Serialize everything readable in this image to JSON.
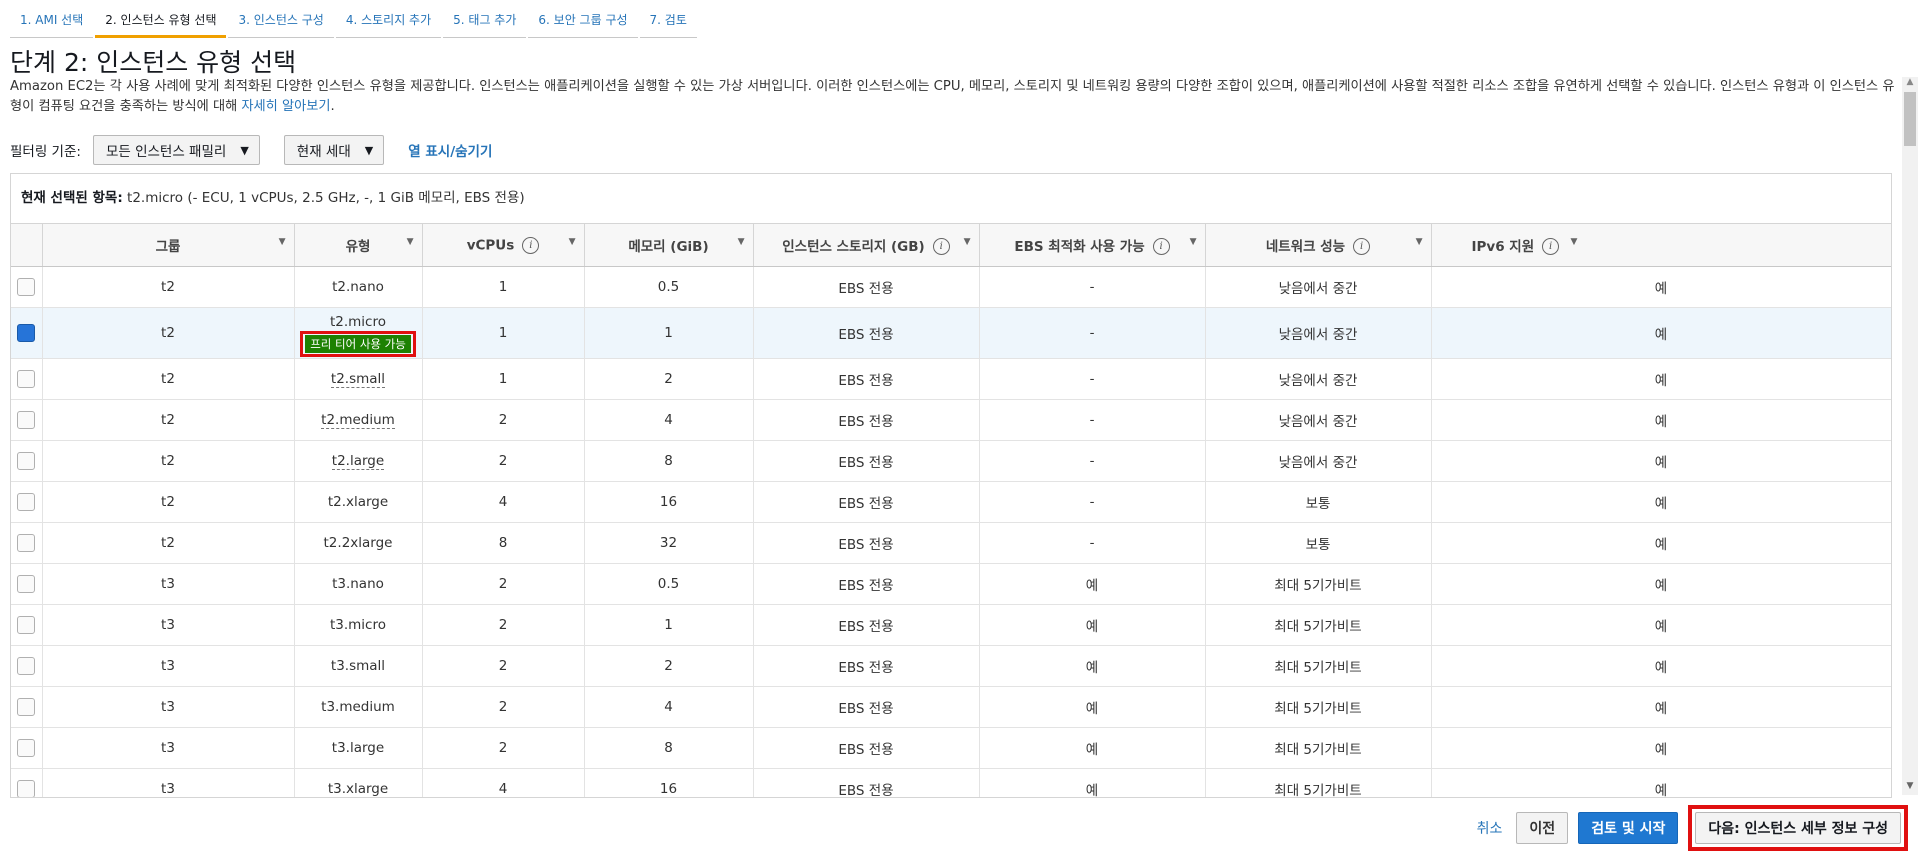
{
  "tabs": [
    {
      "label": "1. AMI 선택"
    },
    {
      "label": "2. 인스턴스 유형 선택"
    },
    {
      "label": "3. 인스턴스 구성"
    },
    {
      "label": "4. 스토리지 추가"
    },
    {
      "label": "5. 태그 추가"
    },
    {
      "label": "6. 보안 그룹 구성"
    },
    {
      "label": "7. 검토"
    }
  ],
  "page": {
    "title": "단계 2: 인스턴스 유형 선택",
    "description": "Amazon EC2는 각 사용 사례에 맞게 최적화된 다양한 인스턴스 유형을 제공합니다. 인스턴스는 애플리케이션을 실행할 수 있는 가상 서버입니다. 이러한 인스턴스에는 CPU, 메모리, 스토리지 및 네트워킹 용량의 다양한 조합이 있으며, 애플리케이션에 사용할 적절한 리소스 조합을 유연하게 선택할 수 있습니다. 인스턴스 유형과 이 인스턴스 유형이 컴퓨팅 요건을 충족하는 방식에 대해 ",
    "learn_more": "자세히 알아보기",
    "learn_more_suffix": "."
  },
  "filter": {
    "label": "필터링 기준:",
    "family": "모든 인스턴스 패밀리",
    "generation": "현재 세대",
    "columns_toggle": "열 표시/숨기기"
  },
  "selection": {
    "label": "현재 선택된 항목:",
    "value": "t2.micro (- ECU, 1 vCPUs, 2.5 GHz, -, 1 GiB 메모리, EBS 전용)"
  },
  "table": {
    "headers": {
      "group": "그룹",
      "type": "유형",
      "vcpus": "vCPUs",
      "memory": "메모리 (GiB)",
      "storage": "인스턴스 스토리지 (GB)",
      "ebs": "EBS 최적화 사용 가능",
      "network": "네트워크 성능",
      "ipv6": "IPv6 지원"
    },
    "free_tier_badge": "프리 티어 사용 가능",
    "rows": [
      {
        "group": "t2",
        "type": "t2.nano",
        "vcpus": "1",
        "memory": "0.5",
        "storage": "EBS 전용",
        "ebs": "-",
        "network": "낮음에서 중간",
        "ipv6": "예"
      },
      {
        "group": "t2",
        "type": "t2.micro",
        "vcpus": "1",
        "memory": "1",
        "storage": "EBS 전용",
        "ebs": "-",
        "network": "낮음에서 중간",
        "ipv6": "예"
      },
      {
        "group": "t2",
        "type": "t2.small",
        "vcpus": "1",
        "memory": "2",
        "storage": "EBS 전용",
        "ebs": "-",
        "network": "낮음에서 중간",
        "ipv6": "예"
      },
      {
        "group": "t2",
        "type": "t2.medium",
        "vcpus": "2",
        "memory": "4",
        "storage": "EBS 전용",
        "ebs": "-",
        "network": "낮음에서 중간",
        "ipv6": "예"
      },
      {
        "group": "t2",
        "type": "t2.large",
        "vcpus": "2",
        "memory": "8",
        "storage": "EBS 전용",
        "ebs": "-",
        "network": "낮음에서 중간",
        "ipv6": "예"
      },
      {
        "group": "t2",
        "type": "t2.xlarge",
        "vcpus": "4",
        "memory": "16",
        "storage": "EBS 전용",
        "ebs": "-",
        "network": "보통",
        "ipv6": "예"
      },
      {
        "group": "t2",
        "type": "t2.2xlarge",
        "vcpus": "8",
        "memory": "32",
        "storage": "EBS 전용",
        "ebs": "-",
        "network": "보통",
        "ipv6": "예"
      },
      {
        "group": "t3",
        "type": "t3.nano",
        "vcpus": "2",
        "memory": "0.5",
        "storage": "EBS 전용",
        "ebs": "예",
        "network": "최대 5기가비트",
        "ipv6": "예"
      },
      {
        "group": "t3",
        "type": "t3.micro",
        "vcpus": "2",
        "memory": "1",
        "storage": "EBS 전용",
        "ebs": "예",
        "network": "최대 5기가비트",
        "ipv6": "예"
      },
      {
        "group": "t3",
        "type": "t3.small",
        "vcpus": "2",
        "memory": "2",
        "storage": "EBS 전용",
        "ebs": "예",
        "network": "최대 5기가비트",
        "ipv6": "예"
      },
      {
        "group": "t3",
        "type": "t3.medium",
        "vcpus": "2",
        "memory": "4",
        "storage": "EBS 전용",
        "ebs": "예",
        "network": "최대 5기가비트",
        "ipv6": "예"
      },
      {
        "group": "t3",
        "type": "t3.large",
        "vcpus": "2",
        "memory": "8",
        "storage": "EBS 전용",
        "ebs": "예",
        "network": "최대 5기가비트",
        "ipv6": "예"
      },
      {
        "group": "t3",
        "type": "t3.xlarge",
        "vcpus": "4",
        "memory": "16",
        "storage": "EBS 전용",
        "ebs": "예",
        "network": "최대 5기가비트",
        "ipv6": "예"
      }
    ]
  },
  "footer": {
    "cancel": "취소",
    "previous": "이전",
    "review_launch": "검토 및 시작",
    "next": "다음: 인스턴스 세부 정보 구성"
  },
  "colors": {
    "link": "#2674b8",
    "primary_button": "#1f78d1",
    "free_tier": "#1d8102",
    "highlight": "#e01010",
    "active_tab": "#f0a000"
  }
}
